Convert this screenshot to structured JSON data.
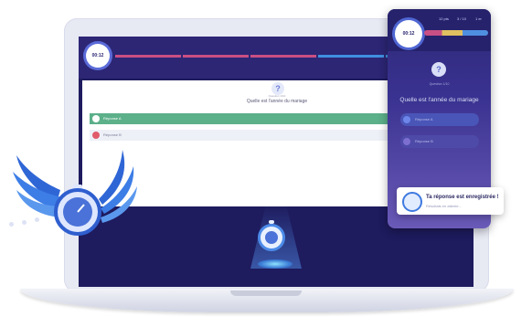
{
  "laptop_quiz": {
    "timer_label": "00:12",
    "question_sub": "Question 1/10",
    "question": "Quelle est l'année du mariage",
    "answers": [
      {
        "label": "Réponse A",
        "color": "#5cb08a"
      },
      {
        "label": "Réponse B",
        "color": "#e05a6a"
      }
    ],
    "progress_colors": [
      "#c94f84",
      "#c94f84",
      "#c94f84",
      "#3f8fe0",
      "#3f8fe0"
    ]
  },
  "phone": {
    "timer_label": "00:12",
    "stats": [
      "12 pts",
      "3 / 10",
      "1 er"
    ],
    "question_sub": "Question 1/10",
    "question": "Quelle est l'année du mariage",
    "answers": [
      {
        "label": "Réponse A",
        "color": "#5b7be0"
      },
      {
        "label": "Réponse B",
        "color": "#6a73c9"
      }
    ]
  },
  "toast": {
    "title": "Ta réponse est enregistrée !",
    "subtitle": "Résultats en attente..."
  },
  "icons": {
    "question": "question-mark-icon",
    "stopwatch": "stopwatch-icon",
    "winged_stopwatch": "winged-stopwatch-icon"
  },
  "colors": {
    "screen_bg": "#1e1b5e",
    "header_bg": "#2c2675",
    "accent_blue": "#4c8be8",
    "answer_green": "#5cb08a"
  }
}
